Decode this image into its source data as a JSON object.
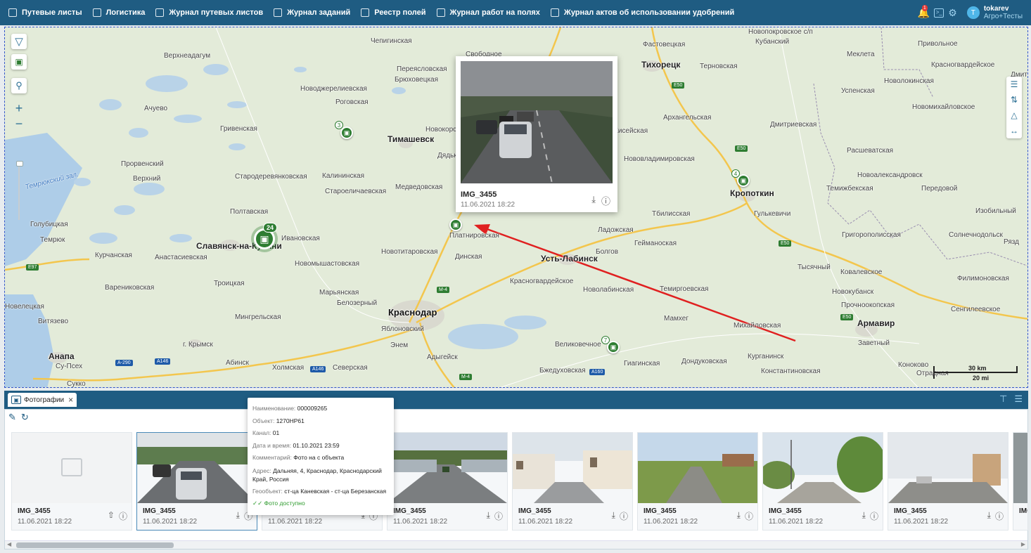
{
  "topbar": {
    "items": [
      "Путевые листы",
      "Логистика",
      "Журнал путевых листов",
      "Журнал заданий",
      "Реестр полей",
      "Журнал работ на полях",
      "Журнал актов об использовании удобрений"
    ],
    "notification_count": "1",
    "user_initial": "T",
    "user_name": "tokarev",
    "user_org": "Агро+Тесты",
    "icons": [
      "bell-icon",
      "terminal-icon",
      "gear-icon"
    ]
  },
  "map": {
    "places": [
      {
        "name": "Чепигинская",
        "kind": "small"
      },
      {
        "name": "Свободное",
        "kind": "small"
      },
      {
        "name": "Новопокровское с/п",
        "kind": "small"
      },
      {
        "name": "Привольное",
        "kind": "small"
      },
      {
        "name": "Верхнеадагум",
        "kind": "small"
      },
      {
        "name": "Фастовецкая",
        "kind": "small"
      },
      {
        "name": "Кубанский",
        "kind": "small"
      },
      {
        "name": "Меклета",
        "kind": "small"
      },
      {
        "name": "Красногвардейское",
        "kind": "small"
      },
      {
        "name": "Переясловская",
        "kind": "small"
      },
      {
        "name": "Брюховецкая",
        "kind": "small"
      },
      {
        "name": "Тихорецк",
        "kind": "city"
      },
      {
        "name": "Терновская",
        "kind": "small"
      },
      {
        "name": "Дмитр",
        "kind": "small"
      },
      {
        "name": "Новоджерелиевская",
        "kind": "small"
      },
      {
        "name": "Роговская",
        "kind": "small"
      },
      {
        "name": "Успенская",
        "kind": "small"
      },
      {
        "name": "Новолокинская",
        "kind": "small"
      },
      {
        "name": "Ачуево",
        "kind": "small"
      },
      {
        "name": "Новомихайловское",
        "kind": "small"
      },
      {
        "name": "Архангельская",
        "kind": "small"
      },
      {
        "name": "Гривенская",
        "kind": "small"
      },
      {
        "name": "Новокорсунская",
        "kind": "small"
      },
      {
        "name": "Тимашевск",
        "kind": "city"
      },
      {
        "name": "Дмитриевская",
        "kind": "small"
      },
      {
        "name": "Кисейская",
        "kind": "small"
      },
      {
        "name": "Расшеватская",
        "kind": "small"
      },
      {
        "name": "Прорвенский",
        "kind": "small"
      },
      {
        "name": "Дядьковская",
        "kind": "small"
      },
      {
        "name": "Нововладимировская",
        "kind": "small"
      },
      {
        "name": "Верхний",
        "kind": "small"
      },
      {
        "name": "Стародеревянковская",
        "kind": "small"
      },
      {
        "name": "Калининская",
        "kind": "small"
      },
      {
        "name": "Новоалександровск",
        "kind": "small"
      },
      {
        "name": "Медведовская",
        "kind": "small"
      },
      {
        "name": "Староеличаевская",
        "kind": "small"
      },
      {
        "name": "Кропоткин",
        "kind": "city"
      },
      {
        "name": "Темижбекская",
        "kind": "small"
      },
      {
        "name": "Передовой",
        "kind": "small"
      },
      {
        "name": "Полтавская",
        "kind": "small"
      },
      {
        "name": "Гулькевичи",
        "kind": "small"
      },
      {
        "name": "Изобильный",
        "kind": "small"
      },
      {
        "name": "Голубицкая",
        "kind": "small"
      },
      {
        "name": "Тбилисская",
        "kind": "small"
      },
      {
        "name": "Ладожская",
        "kind": "small"
      },
      {
        "name": "Григорополисская",
        "kind": "small"
      },
      {
        "name": "Солнечнодольск",
        "kind": "small"
      },
      {
        "name": "Темрюк",
        "kind": "small"
      },
      {
        "name": "Славянск-на-Кубани",
        "kind": "city"
      },
      {
        "name": "Ивановская",
        "kind": "small"
      },
      {
        "name": "Платнировская",
        "kind": "small"
      },
      {
        "name": "Гейманоская",
        "kind": "small"
      },
      {
        "name": "Рязд",
        "kind": "small"
      },
      {
        "name": "Курчанская",
        "kind": "small"
      },
      {
        "name": "Анастасиевская",
        "kind": "small"
      },
      {
        "name": "Новотитаровская",
        "kind": "small"
      },
      {
        "name": "Болгов",
        "kind": "small"
      },
      {
        "name": "Динская",
        "kind": "small"
      },
      {
        "name": "Усть-Лабинск",
        "kind": "city"
      },
      {
        "name": "Тысячный",
        "kind": "small"
      },
      {
        "name": "Ковалевское",
        "kind": "small"
      },
      {
        "name": "Новомышастовская",
        "kind": "small"
      },
      {
        "name": "Красногвардейское",
        "kind": "small"
      },
      {
        "name": "Филимоновская",
        "kind": "small"
      },
      {
        "name": "Варениковская",
        "kind": "small"
      },
      {
        "name": "Троицкая",
        "kind": "small"
      },
      {
        "name": "Марьянская",
        "kind": "small"
      },
      {
        "name": "Новолабинская",
        "kind": "small"
      },
      {
        "name": "Темиргоевская",
        "kind": "small"
      },
      {
        "name": "Новокубанск",
        "kind": "small"
      },
      {
        "name": "Белозерный",
        "kind": "small"
      },
      {
        "name": "Прочноокопская",
        "kind": "small"
      },
      {
        "name": "Сенгилеевское",
        "kind": "small"
      },
      {
        "name": "Краснодар",
        "kind": "big"
      },
      {
        "name": "Новелецкая",
        "kind": "small"
      },
      {
        "name": "Мингрельская",
        "kind": "small"
      },
      {
        "name": "Мамхег",
        "kind": "small"
      },
      {
        "name": "Армавир",
        "kind": "city"
      },
      {
        "name": "Витязево",
        "kind": "small"
      },
      {
        "name": "Яблоновский",
        "kind": "small"
      },
      {
        "name": "Михайловская",
        "kind": "small"
      },
      {
        "name": "Заветный",
        "kind": "small"
      },
      {
        "name": "г. Крымск",
        "kind": "small"
      },
      {
        "name": "Энем",
        "kind": "small"
      },
      {
        "name": "Великовечное",
        "kind": "small"
      },
      {
        "name": "Анапа",
        "kind": "city"
      },
      {
        "name": "Адыгейск",
        "kind": "small"
      },
      {
        "name": "Курганинск",
        "kind": "small"
      },
      {
        "name": "Су-Псех",
        "kind": "small"
      },
      {
        "name": "Абинск",
        "kind": "small"
      },
      {
        "name": "Холмская",
        "kind": "small"
      },
      {
        "name": "Северская",
        "kind": "small"
      },
      {
        "name": "Гиагинская",
        "kind": "small"
      },
      {
        "name": "Дондуковская",
        "kind": "small"
      },
      {
        "name": "Константиновская",
        "kind": "small"
      },
      {
        "name": "Коноково",
        "kind": "small"
      },
      {
        "name": "Бжедуховская",
        "kind": "small"
      },
      {
        "name": "Отрадная",
        "kind": "small"
      },
      {
        "name": "Сукко",
        "kind": "small"
      }
    ],
    "water_label": "Темрюкский зал.",
    "road_badges": [
      "E50",
      "E50",
      "E50",
      "E50",
      "E97",
      "M-4",
      "M-4",
      "A146",
      "A146",
      "A160",
      "A-290"
    ],
    "markers": [
      {
        "count": "3"
      },
      {
        "count": "4"
      },
      {
        "count": "7"
      }
    ],
    "cluster_count": "24",
    "scale_km": "30 km",
    "scale_mi": "20 mi",
    "popup": {
      "name": "IMG_3455",
      "date": "11.06.2021 18:22"
    }
  },
  "panel": {
    "tab_label": "Фотографии",
    "cards": [
      {
        "name": "IMG_3455",
        "date": "11.06.2021 18:22",
        "image": "placeholder"
      },
      {
        "name": "IMG_3455",
        "date": "11.06.2021 18:22",
        "image": "road"
      },
      {
        "name": "",
        "date": "11.06.2021 18:22",
        "image": "road"
      },
      {
        "name": "IMG_3455",
        "date": "11.06.2021 18:22",
        "image": "highway"
      },
      {
        "name": "IMG_3455",
        "date": "11.06.2021 18:22",
        "image": "street"
      },
      {
        "name": "IMG_3455",
        "date": "11.06.2021 18:22",
        "image": "field-road"
      },
      {
        "name": "IMG_3455",
        "date": "11.06.2021 18:22",
        "image": "village"
      },
      {
        "name": "IMG_3455",
        "date": "11.06.2021 18:22",
        "image": "town"
      },
      {
        "name": "IMG",
        "date": "",
        "image": "partial"
      }
    ],
    "tooltip": {
      "name_label": "Наименование:",
      "name_value": "000009265",
      "object_label": "Объект:",
      "object_value": "1270НР61",
      "channel_label": "Канал:",
      "channel_value": "01",
      "datetime_label": "Дата и время:",
      "datetime_value": "01.10.2021 23:59",
      "comment_label": "Комментарий:",
      "comment_value": "Фото на с объекта",
      "address_label": "Адрес:",
      "address_value": "Дальняя, 4, Краснодар, Краснодарский Край, Россия",
      "geo_label": "Геообъект:",
      "geo_value": "ст-ца Каневская - ст-ца Березанская",
      "status": "Фото доступно"
    }
  },
  "colors": {
    "header": "#1f5c82",
    "marker": "#2e7d32",
    "arrow": "#e02020"
  }
}
